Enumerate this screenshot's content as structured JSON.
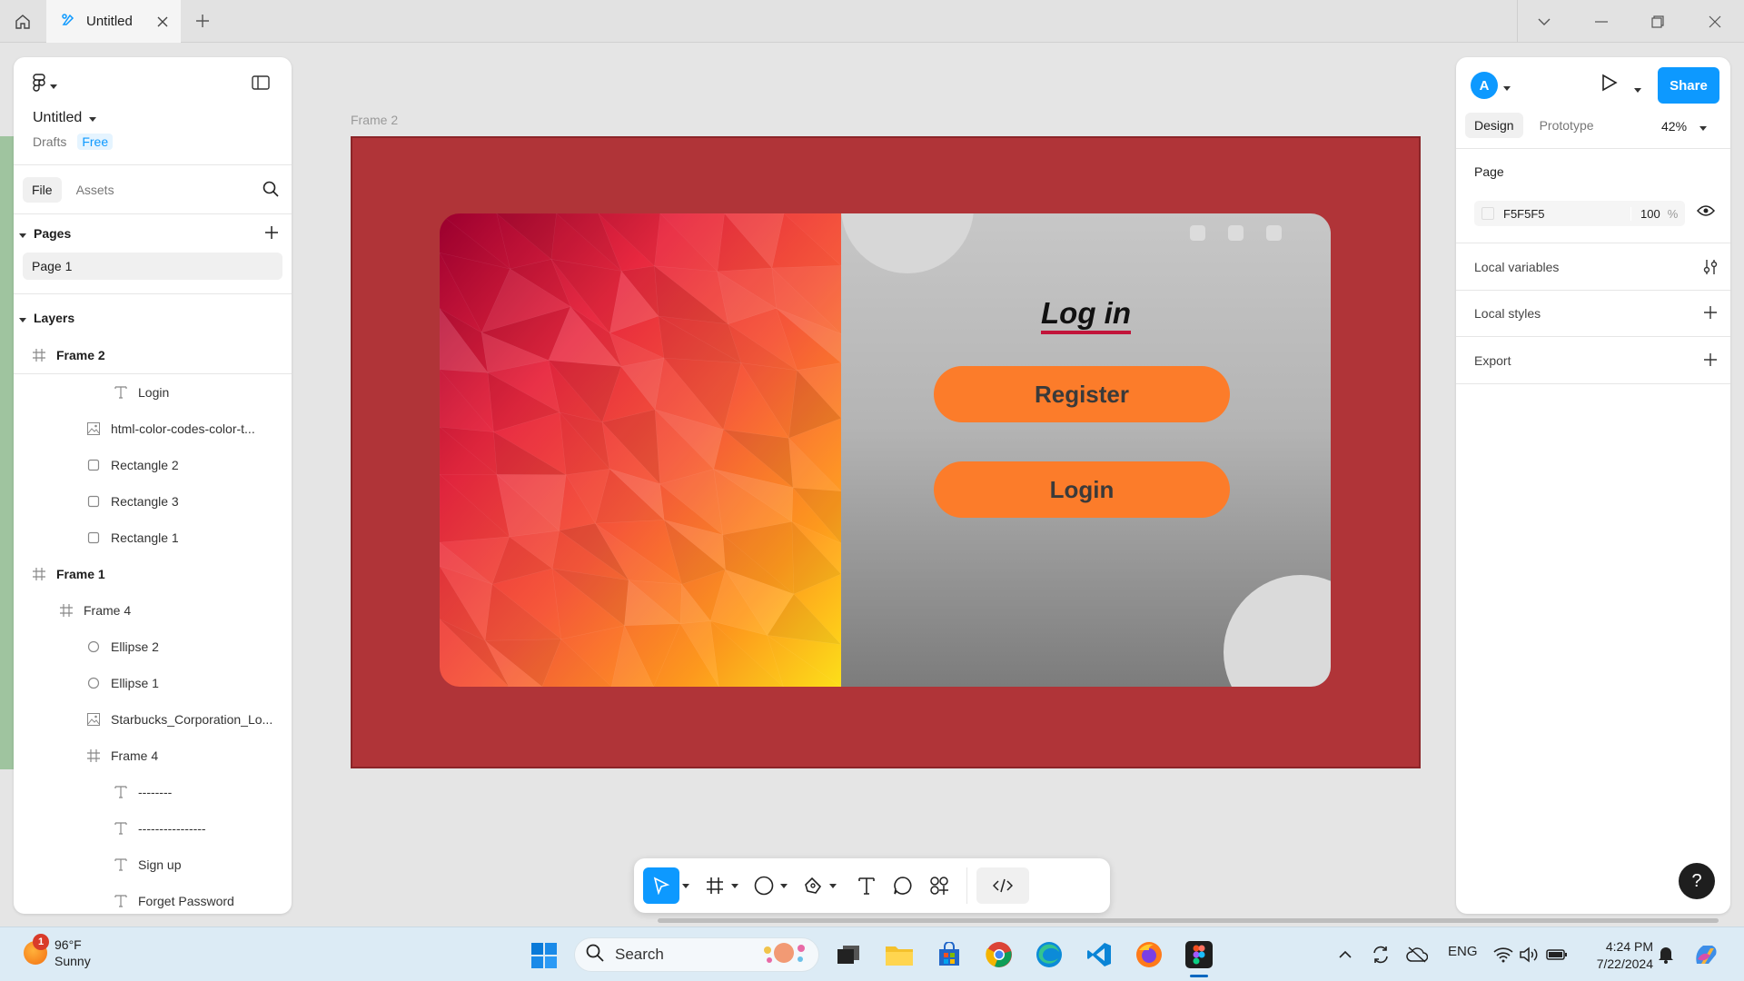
{
  "browser": {
    "tab_title": "Untitled",
    "home_icon": "home-icon",
    "close_icon": "close-icon",
    "new_tab_icon": "plus-icon"
  },
  "left_panel": {
    "file_title": "Untitled",
    "location": "Drafts",
    "plan": "Free",
    "tabs": [
      "File",
      "Assets"
    ],
    "pages_heading": "Pages",
    "pages": [
      "Page 1"
    ],
    "layers_heading": "Layers",
    "layers": [
      {
        "name": "Frame 2",
        "type": "frame",
        "indent": 0,
        "bold": true
      },
      {
        "name": "Login",
        "type": "text",
        "indent": 3
      },
      {
        "name": "html-color-codes-color-t...",
        "type": "image",
        "indent": 2
      },
      {
        "name": "Rectangle 2",
        "type": "rect",
        "indent": 2
      },
      {
        "name": "Rectangle 3",
        "type": "rect",
        "indent": 2
      },
      {
        "name": "Rectangle 1",
        "type": "rect",
        "indent": 2
      },
      {
        "name": "Frame 1",
        "type": "frame",
        "indent": 0,
        "bold": true
      },
      {
        "name": "Frame 4",
        "type": "frame",
        "indent": 1
      },
      {
        "name": "Ellipse 2",
        "type": "ellipse",
        "indent": 2
      },
      {
        "name": "Ellipse 1",
        "type": "ellipse",
        "indent": 2
      },
      {
        "name": "Starbucks_Corporation_Lo...",
        "type": "image",
        "indent": 2
      },
      {
        "name": "Frame 4",
        "type": "frame",
        "indent": 2
      },
      {
        "name": "--------",
        "type": "text",
        "indent": 3
      },
      {
        "name": "----------------",
        "type": "text",
        "indent": 3
      },
      {
        "name": "Sign up",
        "type": "text",
        "indent": 3
      },
      {
        "name": "Forget Password",
        "type": "text",
        "indent": 3
      }
    ]
  },
  "canvas": {
    "frame_label": "Frame 2",
    "frame_color": "#b03438",
    "login_title": "Log in",
    "register_button": "Register",
    "login_button": "Login",
    "accent_orange": "#fc7c2a",
    "underline_color": "#c2143a"
  },
  "toolbar": {
    "tools": [
      "move-icon",
      "frame-icon",
      "ellipse-icon",
      "pen-icon",
      "text-icon",
      "comment-icon",
      "components-icon",
      "dev-mode-icon"
    ]
  },
  "right_panel": {
    "avatar_letter": "A",
    "share_label": "Share",
    "tabs": [
      "Design",
      "Prototype"
    ],
    "zoom": "42%",
    "page_heading": "Page",
    "page_color_hex": "F5F5F5",
    "page_opacity": "100",
    "percent_sign": "%",
    "rows": [
      "Local variables",
      "Local styles",
      "Export"
    ],
    "help": "?"
  },
  "taskbar": {
    "temperature": "96°F",
    "condition": "Sunny",
    "weather_badge": "1",
    "search_placeholder": "Search",
    "language": "ENG",
    "time": "4:24 PM",
    "date": "7/22/2024"
  }
}
